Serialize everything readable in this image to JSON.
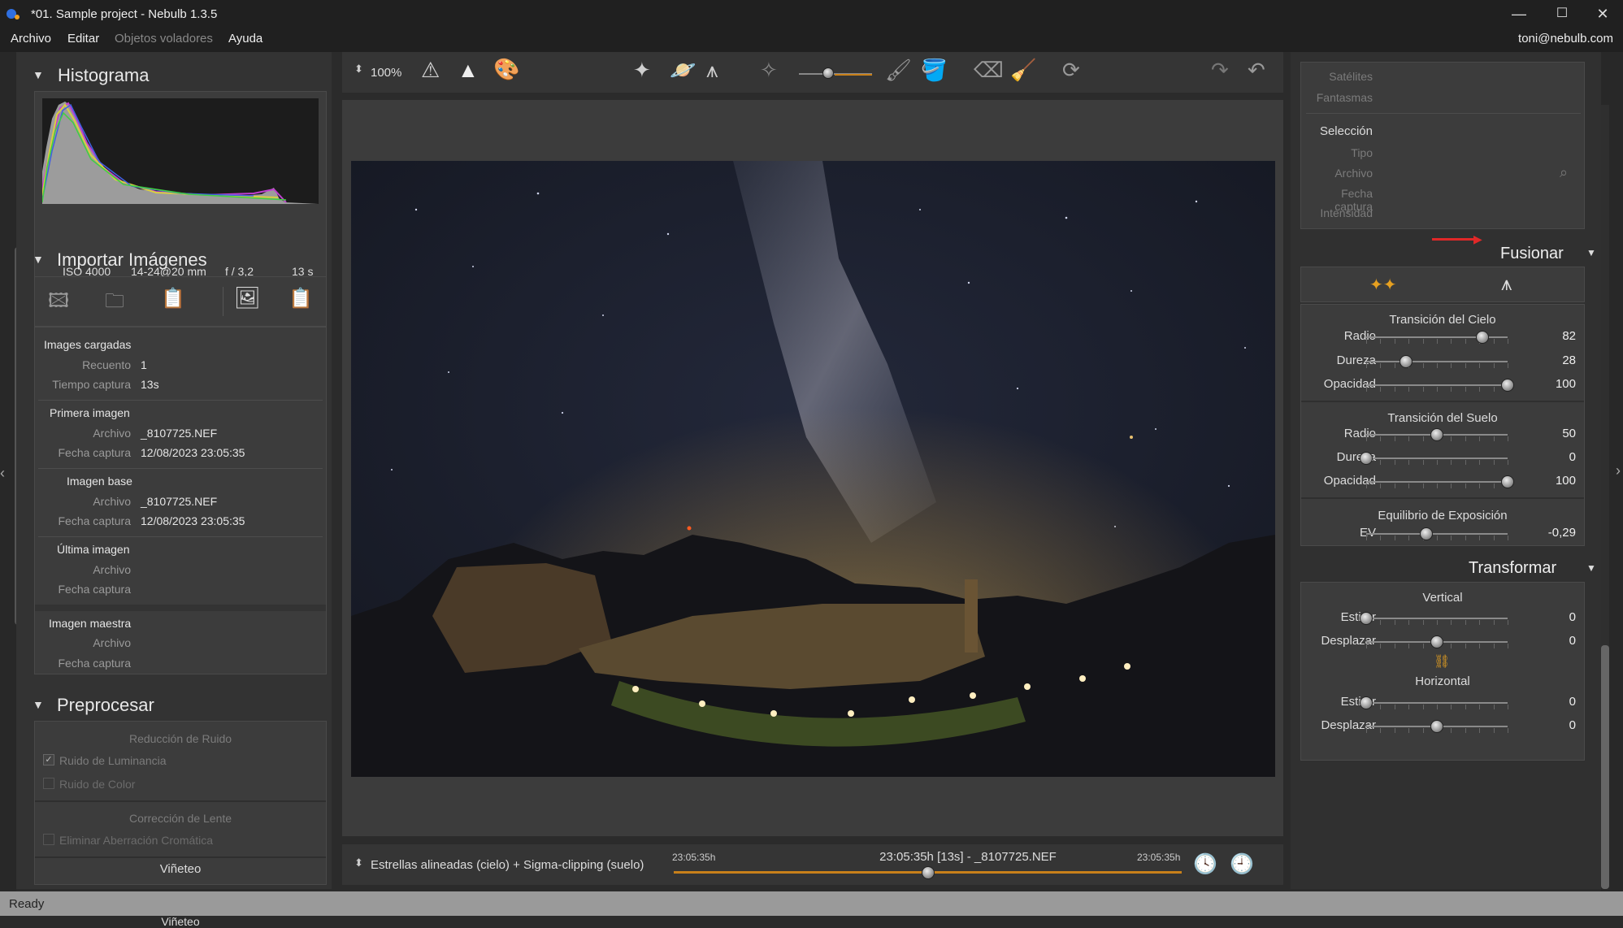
{
  "window": {
    "title": "*01. Sample project - Nebulb 1.3.5",
    "min": "—",
    "max": "☐",
    "close": "✕"
  },
  "menu": {
    "archivo": "Archivo",
    "editar": "Editar",
    "objetos": "Objetos voladores",
    "ayuda": "Ayuda",
    "user": "toni@nebulb.com"
  },
  "status": "Ready",
  "histogram": {
    "title": "Histograma",
    "iso": "ISO 4000",
    "lens": "14-24@20 mm",
    "aperture": "f / 3,2",
    "exposure": "13 s"
  },
  "import": {
    "title": "Importar Imágenes",
    "loaded": {
      "title": "Images cargadas",
      "count_label": "Recuento",
      "count": "1",
      "time_label": "Tiempo captura",
      "time": "13s"
    },
    "first": {
      "title": "Primera imagen",
      "file_label": "Archivo",
      "file": "_8107725.NEF",
      "date_label": "Fecha captura",
      "date": "12/08/2023 23:05:35"
    },
    "base": {
      "title": "Imagen base",
      "file_label": "Archivo",
      "file": "_8107725.NEF",
      "date_label": "Fecha captura",
      "date": "12/08/2023 23:05:35"
    },
    "last": {
      "title": "Última imagen",
      "file_label": "Archivo",
      "date_label": "Fecha captura"
    },
    "master": {
      "title": "Imagen maestra",
      "file_label": "Archivo",
      "date_label": "Fecha captura"
    }
  },
  "preprocess": {
    "title": "Preprocesar",
    "noise": "Reducción de Ruido",
    "lum": "Ruido de Luminancia",
    "color": "Ruido de Color",
    "lens": "Corrección de Lente",
    "ca": "Eliminar Aberración Cromática",
    "vignette": "Viñeteo"
  },
  "toolbar": {
    "zoom": "100%"
  },
  "bottom": {
    "mode": "Estrellas alineadas (cielo) + Sigma-clipping (suelo)",
    "t_start": "23:05:35h",
    "center": "23:05:35h [13s] - _8107725.NEF",
    "t_end": "23:05:35h",
    "timeline_pos": 0.5
  },
  "right": {
    "satellites": "Satélites",
    "ghosts": "Fantasmas",
    "selection": "Selección",
    "type": "Tipo",
    "file": "Archivo",
    "date": "Fecha captura",
    "intensity": "Intensidad",
    "merge": "Fusionar",
    "sky": {
      "title": "Transición del Cielo",
      "radius_label": "Radio",
      "radius": "82",
      "hard_label": "Dureza",
      "hard": "28",
      "op_label": "Opacidad",
      "op": "100"
    },
    "ground": {
      "title": "Transición del Suelo",
      "radius_label": "Radio",
      "radius": "50",
      "hard_label": "Dureza",
      "hard": "0",
      "op_label": "Opacidad",
      "op": "100"
    },
    "exposure": {
      "title": "Equilibrio de Exposición",
      "ev_label": "EV",
      "ev": "-0,29"
    },
    "transform": "Transformar",
    "vertical": {
      "title": "Vertical",
      "stretch_label": "Estirar",
      "stretch": "0",
      "shift_label": "Desplazar",
      "shift": "0"
    },
    "horizontal": {
      "title": "Horizontal",
      "stretch_label": "Estirar",
      "stretch": "0",
      "shift_label": "Desplazar",
      "shift": "0"
    }
  }
}
